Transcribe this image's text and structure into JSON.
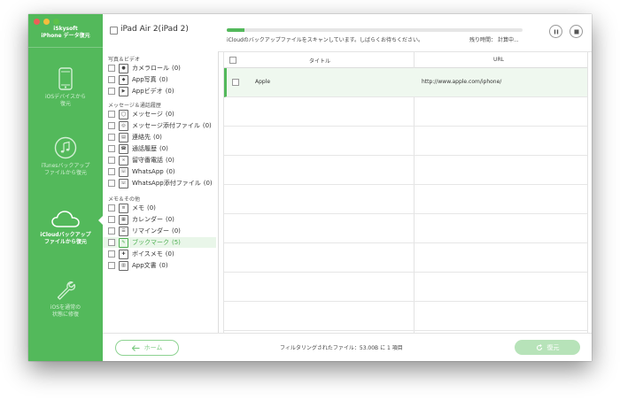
{
  "sidebar": {
    "brand_name": "iSkysoft",
    "product_name": "iPhone データ復元",
    "nav": [
      {
        "label_line1": "iOSデバイスから",
        "label_line2": "復元",
        "icon": "iphone-icon"
      },
      {
        "label_line1": "iTunesバックアップ",
        "label_line2": "ファイルから復元",
        "icon": "music-note-icon"
      },
      {
        "label_line1": "iCloudバックアップ",
        "label_line2": "ファイルから復元",
        "icon": "cloud-icon"
      },
      {
        "label_line1": "iOSを通常の",
        "label_line2": "状態に修復",
        "icon": "wrench-icon"
      }
    ]
  },
  "header": {
    "device_name": "iPad Air 2(iPad 2)",
    "scan_status": "iCloudのバックアップファイルをスキャンしています。しばらくお待ちください。",
    "remaining_label": "残り時間：",
    "remaining_value": "計算中...",
    "progress": 0.06
  },
  "categories": [
    {
      "group": "写真＆ビデオ",
      "items": [
        {
          "label": "カメラロール",
          "count": "(0)",
          "icon": "camera-icon"
        },
        {
          "label": "App写真",
          "count": "(0)",
          "icon": "app-photo-icon"
        },
        {
          "label": "Appビデオ",
          "count": "(0)",
          "icon": "app-video-icon"
        }
      ]
    },
    {
      "group": "メッセージ＆通話履歴",
      "items": [
        {
          "label": "メッセージ",
          "count": "(0)",
          "icon": "message-icon"
        },
        {
          "label": "メッセージ添付ファイル",
          "count": "(0)",
          "icon": "attachment-icon"
        },
        {
          "label": "連絡先",
          "count": "(0)",
          "icon": "contacts-icon"
        },
        {
          "label": "通話履歴",
          "count": "(0)",
          "icon": "phone-icon"
        },
        {
          "label": "留守番電話",
          "count": "(0)",
          "icon": "voicemail-icon"
        },
        {
          "label": "WhatsApp",
          "count": "(0)",
          "icon": "whatsapp-icon"
        },
        {
          "label": "WhatsApp添付ファイル",
          "count": "(0)",
          "icon": "whatsapp-attachment-icon"
        }
      ]
    },
    {
      "group": "メモ＆その他",
      "items": [
        {
          "label": "メモ",
          "count": "(0)",
          "icon": "notes-icon"
        },
        {
          "label": "カレンダー",
          "count": "(0)",
          "icon": "calendar-icon"
        },
        {
          "label": "リマインダー",
          "count": "(0)",
          "icon": "reminder-icon"
        },
        {
          "label": "ブックマーク",
          "count": "(5)",
          "icon": "bookmark-icon"
        },
        {
          "label": "ボイスメモ",
          "count": "(0)",
          "icon": "voice-memo-icon"
        },
        {
          "label": "App文書",
          "count": "(0)",
          "icon": "app-document-icon"
        }
      ]
    }
  ],
  "table": {
    "columns": {
      "title": "タイトル",
      "url": "URL"
    },
    "rows": [
      {
        "title": "Apple",
        "url": "http://www.apple.com/iphone/"
      }
    ]
  },
  "footer": {
    "home_label": "ホーム",
    "filter_status": "フィルタリングされたファイル：53.00B に 1 項目",
    "recover_label": "復元"
  },
  "colors": {
    "accent": "#53b95b",
    "highlight": "#e9f6e9"
  }
}
